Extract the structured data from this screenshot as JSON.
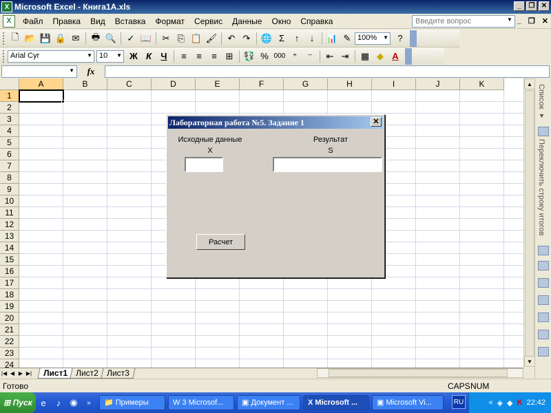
{
  "window": {
    "title": "Microsoft Excel - Книга1А.xls",
    "minimize": "_",
    "restore": "❐",
    "close": "✕"
  },
  "menu": {
    "items": [
      "Файл",
      "Правка",
      "Вид",
      "Вставка",
      "Формат",
      "Сервис",
      "Данные",
      "Окно",
      "Справка"
    ],
    "help_placeholder": "Введите вопрос",
    "doc_controls": {
      "minimize": "_",
      "restore": "❐",
      "close": "✕"
    }
  },
  "toolbar_standard": {
    "zoom": "100%"
  },
  "toolbar_format": {
    "font": "Arial Cyr",
    "size": "10",
    "bold": "Ж",
    "italic": "К",
    "underline": "Ч",
    "percent": "%",
    "thousands": "000"
  },
  "formula_bar": {
    "fx": "fx"
  },
  "grid": {
    "columns": [
      "A",
      "B",
      "C",
      "D",
      "E",
      "F",
      "G",
      "H",
      "I",
      "J",
      "K"
    ],
    "rows": [
      "1",
      "2",
      "3",
      "4",
      "5",
      "6",
      "7",
      "8",
      "9",
      "10",
      "11",
      "12",
      "13",
      "14",
      "15",
      "16",
      "17",
      "18",
      "19",
      "20",
      "21",
      "22",
      "23",
      "24"
    ],
    "active_column": "A",
    "active_row": "1"
  },
  "sheets": {
    "tabs": [
      "Лист1",
      "Лист2",
      "Лист3"
    ],
    "active": "Лист1"
  },
  "status": {
    "left": "Готово",
    "caps": "CAPS",
    "num": "NUM"
  },
  "task_pane": {
    "top_label": "Список ▾",
    "side_label": "Переключить строку итогов"
  },
  "dialog": {
    "title": "Лабораторная работа №5. Задание 1",
    "close": "✕",
    "left_heading": "Исходные данные",
    "left_var": "X",
    "right_heading": "Результат",
    "right_var": "S",
    "x_value": "",
    "s_value": "",
    "button": "Расчет"
  },
  "taskbar": {
    "start": "Пуск",
    "tasks": [
      "Примеры",
      "3 Microsof...",
      "Документ ...",
      "Microsoft ...",
      "Microsoft Vi..."
    ],
    "active_task": "Microsoft ...",
    "lang": "RU",
    "clock": "22:42"
  }
}
